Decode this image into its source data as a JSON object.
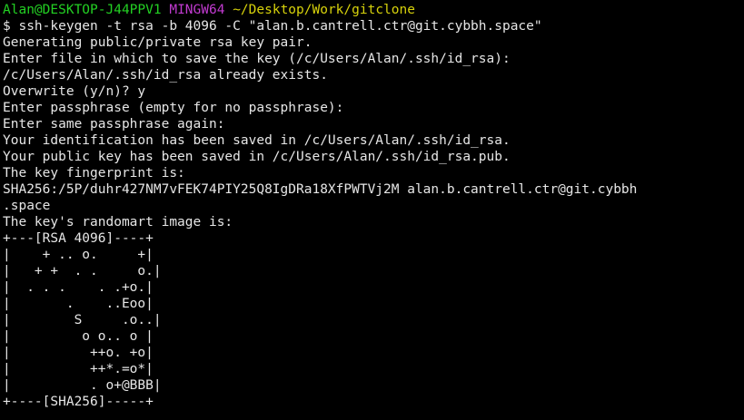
{
  "prompt": {
    "user_host": "Alan@DESKTOP-J44PPV1",
    "system": "MINGW64",
    "cwd": "~/Desktop/Work/gitclone",
    "colors": {
      "user_host": "#23d023",
      "system": "#c23bd1",
      "cwd": "#d7d20b",
      "text": "#e6e6e6",
      "background": "#000000"
    }
  },
  "command": "$ ssh-keygen -t rsa -b 4096 -C \"alan.b.cantrell.ctr@git.cybbh.space\"",
  "output": [
    "Generating public/private rsa key pair.",
    "Enter file in which to save the key (/c/Users/Alan/.ssh/id_rsa):",
    "/c/Users/Alan/.ssh/id_rsa already exists.",
    "Overwrite (y/n)? y",
    "Enter passphrase (empty for no passphrase):",
    "Enter same passphrase again:",
    "Your identification has been saved in /c/Users/Alan/.ssh/id_rsa.",
    "Your public key has been saved in /c/Users/Alan/.ssh/id_rsa.pub.",
    "The key fingerprint is:",
    "SHA256:/5P/duhr427NM7vFEK74PIY25Q8IgDRa18XfPWTVj2M alan.b.cantrell.ctr@git.cybbh",
    ".space",
    "The key's randomart image is:"
  ],
  "randomart": [
    "+---[RSA 4096]----+",
    "|    + .. o.     +|",
    "|   + +  . .     o.|",
    "|  . . .    . .+o.|",
    "|       .    ..Eoo|",
    "|        S     .o..|",
    "|         o o.. o |",
    "|          ++o. +o|",
    "|          ++*.=o*|",
    "|          . o+@BBB|",
    "+----[SHA256]-----+"
  ]
}
